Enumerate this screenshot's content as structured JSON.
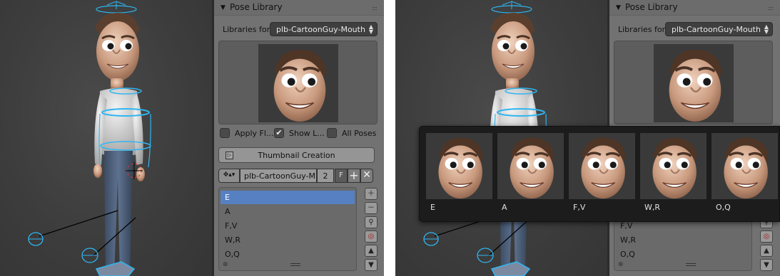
{
  "left": {
    "panel_title": "Pose Library",
    "libraries_label": "Libraries for",
    "library_select": "plb-CartoonGuy-Mouth",
    "checkboxes": [
      {
        "label": "Apply Fl...",
        "checked": false
      },
      {
        "label": "Show L...",
        "checked": true
      },
      {
        "label": "All Poses",
        "checked": false
      }
    ],
    "thumb_button": "Thumbnail Creation",
    "id_block": {
      "name": "plb-CartoonGuy-M...",
      "users": "2",
      "fake": "F"
    },
    "poses": [
      "E",
      "A",
      "F,V",
      "W,R",
      "O,Q"
    ],
    "selected_pose": "E"
  },
  "right": {
    "panel_title": "Pose Library",
    "libraries_label": "Libraries for",
    "library_select": "plb-CartoonGuy-Mouth",
    "poses_visible": [
      "F,V",
      "W,R",
      "O,Q"
    ]
  },
  "popup": {
    "items": [
      "E",
      "A",
      "F,V",
      "W,R",
      "O,Q"
    ]
  },
  "colors": {
    "selection": "#5680c2",
    "bone_outline": "#2fb6f2",
    "panel_bg": "#727272",
    "viewport_bg": "#3d3d3d"
  }
}
